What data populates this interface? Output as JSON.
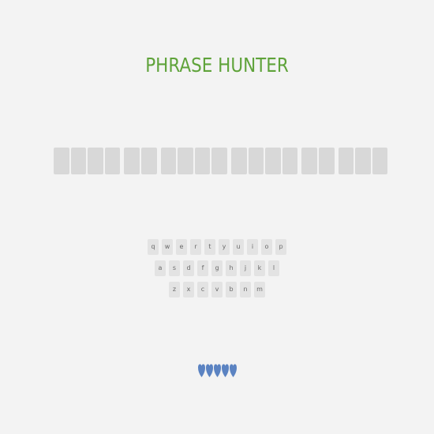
{
  "header": {
    "title": "PHRASE HUNTER"
  },
  "phrase": {
    "word_lengths": [
      4,
      2,
      4,
      4,
      2,
      3
    ],
    "box_color": "#d8d8d8"
  },
  "keyboard": {
    "rows": [
      [
        "q",
        "w",
        "e",
        "r",
        "t",
        "y",
        "u",
        "i",
        "o",
        "p"
      ],
      [
        "a",
        "s",
        "d",
        "f",
        "g",
        "h",
        "j",
        "k",
        "l"
      ],
      [
        "z",
        "x",
        "c",
        "v",
        "b",
        "n",
        "m"
      ]
    ]
  },
  "scoreboard": {
    "lives_remaining": 5,
    "heart_icon": "heart-icon",
    "heart_color": "#5b83c2"
  },
  "colors": {
    "title": "#5fa33a",
    "background": "#f3f3f3",
    "key_background": "#e3e3e3"
  }
}
